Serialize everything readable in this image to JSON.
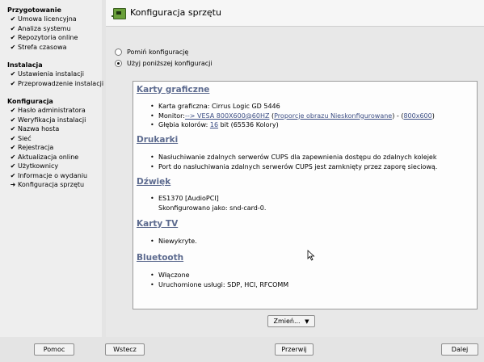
{
  "sidebar": {
    "sections": [
      {
        "heading": "Przygotowanie",
        "items": [
          {
            "label": "Umowa licencyjna",
            "mark": "✔"
          },
          {
            "label": "Analiza systemu",
            "mark": "✔"
          },
          {
            "label": "Repozytoria online",
            "mark": "✔"
          },
          {
            "label": "Strefa czasowa",
            "mark": "✔"
          }
        ]
      },
      {
        "heading": "Instalacja",
        "items": [
          {
            "label": "Ustawienia instalacji",
            "mark": "✔"
          },
          {
            "label": "Przeprowadzenie instalacji",
            "mark": "✔"
          }
        ]
      },
      {
        "heading": "Konfiguracja",
        "items": [
          {
            "label": "Hasło administratora",
            "mark": "✔"
          },
          {
            "label": "Weryfikacja instalacji",
            "mark": "✔"
          },
          {
            "label": "Nazwa hosta",
            "mark": "✔"
          },
          {
            "label": "Sieć",
            "mark": "✔"
          },
          {
            "label": "Rejestracja",
            "mark": "✔"
          },
          {
            "label": "Aktualizacja online",
            "mark": "✔"
          },
          {
            "label": "Użytkownicy",
            "mark": "✔"
          },
          {
            "label": "Informacje o wydaniu",
            "mark": "✔"
          },
          {
            "label": "Konfiguracja sprzętu",
            "mark": "➜"
          }
        ]
      }
    ]
  },
  "header": {
    "title": "Konfiguracja sprzętu"
  },
  "options": {
    "skip_label": "Pomiń konfigurację",
    "use_label": "Użyj poniższej konfiguracji",
    "selected": "use"
  },
  "summary": {
    "graphics": {
      "title": "Karty graficzne",
      "card": "Karta graficzna: Cirrus Logic GD 5446",
      "monitor_prefix": "Monitor:",
      "monitor_link": "--> VESA 800X600@60HZ",
      "aspect_link": "Proporcje obrazu Nieskonfigurowane",
      "resolution_link": "800x600",
      "depth_prefix": "Głębia kolorów:",
      "depth_link": "16",
      "depth_suffix": "bit (65536 Kolory)"
    },
    "printers": {
      "title": "Drukarki",
      "line1": "Nasłuchiwanie zdalnych serwerów CUPS dla zapewnienia dostępu do zdalnych kolejek",
      "line2": "Port do nasłuchiwania zdalnych serwerów CUPS jest zamknięty przez zaporę sieciową."
    },
    "sound": {
      "title": "Dźwięk",
      "device": "ES1370 [AudioPCI]",
      "configured": "Skonfigurowano jako: snd-card-0."
    },
    "tv": {
      "title": "Karty TV",
      "line1": "Niewykryte."
    },
    "bluetooth": {
      "title": "Bluetooth",
      "line1": "Włączone",
      "line2": "Uruchomione usługi: SDP, HCI, RFCOMM"
    }
  },
  "change_button": {
    "label": "Zmień...",
    "arrow": "▼"
  },
  "footer": {
    "help": "Pomoc",
    "back": "Wstecz",
    "abort": "Przerwij",
    "next": "Dalej"
  },
  "icons": {
    "app": "hardware-card-icon",
    "cursor": "mouse-pointer-icon"
  }
}
